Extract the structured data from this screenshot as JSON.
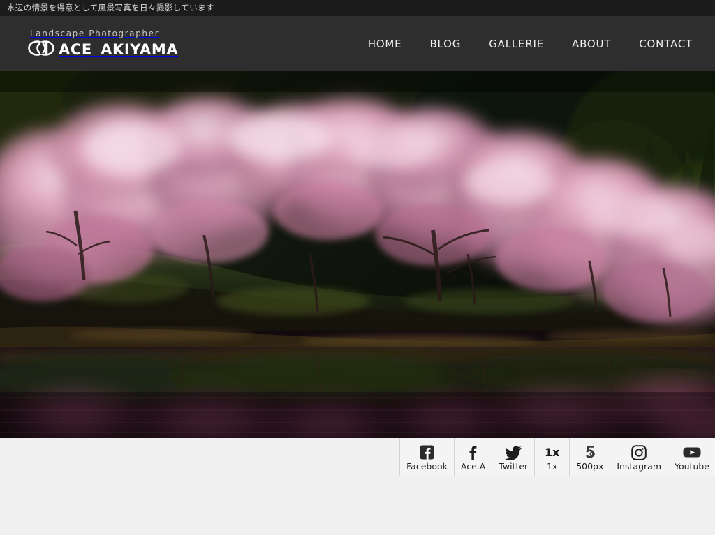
{
  "colors": {
    "topbar_bg": "#1c1c1c",
    "header_bg": "#2e2e2e",
    "page_bg": "#f0f0f0",
    "social_bg": "#f4f4f4",
    "nav_text": "#efefef",
    "brand_sub": "#c9c9c9",
    "icon_dark": "#1d1d1d",
    "blossom_pink": "#e2a3bd",
    "blossom_light": "#f2cfdd",
    "water_dark": "#191014",
    "foliage_dark": "#16200f"
  },
  "topbar": {
    "tagline": "水辺の情景を得意として風景写真を日々撮影しています"
  },
  "header": {
    "brand": {
      "subtitle": "Landscape Photographer",
      "logo_mark": "overlapping-circles-logo",
      "name_part1": "ACE",
      "name_part2": "AKIYAMA",
      "name_full": "ACE AKIYAMA"
    },
    "nav": [
      {
        "label": "HOME",
        "name": "home"
      },
      {
        "label": "BLOG",
        "name": "blog"
      },
      {
        "label": "GALLERIE",
        "name": "gallerie"
      },
      {
        "label": "ABOUT",
        "name": "about"
      },
      {
        "label": "CONTACT",
        "name": "contact"
      }
    ]
  },
  "hero": {
    "alt": "Cherry blossom trees in bloom along a lakeshore reflected in dark still water",
    "subject": "sakura-lakeside-reflection"
  },
  "footer": {
    "social": [
      {
        "label": "Facebook",
        "icon": "facebook-square-icon"
      },
      {
        "label": "Ace.A",
        "icon": "facebook-f-icon"
      },
      {
        "label": "Twitter",
        "icon": "twitter-bird-icon"
      },
      {
        "label": "1x",
        "icon": "onex-text-icon",
        "icon_text": "1x"
      },
      {
        "label": "500px",
        "icon": "fivehundredpx-icon"
      },
      {
        "label": "Instagram",
        "icon": "instagram-camera-icon"
      },
      {
        "label": "Youtube",
        "icon": "youtube-play-icon"
      }
    ]
  }
}
